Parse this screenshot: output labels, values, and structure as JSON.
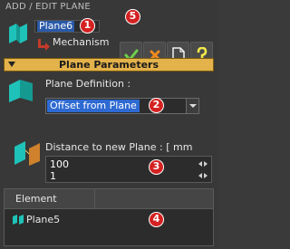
{
  "window": {
    "title": "ADD / EDIT PLANE"
  },
  "header": {
    "name_value": "Plane6",
    "parent_label": "Mechanism"
  },
  "badges": [
    "1",
    "2",
    "3",
    "4",
    "5"
  ],
  "toolbar": {
    "ok_label": "✓",
    "cancel_label": "✕",
    "new_label": "",
    "help_label": "?"
  },
  "section": {
    "title": "Plane Parameters"
  },
  "definition": {
    "label": "Plane Definition :",
    "selected": "Offset from Plane"
  },
  "distance": {
    "label": "Distance to new Plane : [ mm",
    "value1": "100",
    "value2": "1"
  },
  "table": {
    "columns": [
      "Element",
      ""
    ],
    "rows": [
      {
        "element": "Plane5"
      }
    ]
  },
  "colors": {
    "panel_bg": "#383838",
    "section_bar": "#e3b24a",
    "accent_teal": "#1fc2b8",
    "selection_blue": "#2e6ad2",
    "badge_red": "#d42121",
    "ok_green": "#6fd24a",
    "cancel_orange": "#f08a1c"
  },
  "icons": [
    "plane-logo-icon",
    "red-arrow-icon",
    "check-icon",
    "cross-icon",
    "new-document-icon",
    "help-icon",
    "plane-definition-icon",
    "distance-plane-icon",
    "plane-element-icon",
    "dropdown-chevron-icon",
    "spin-arrows-icon"
  ]
}
